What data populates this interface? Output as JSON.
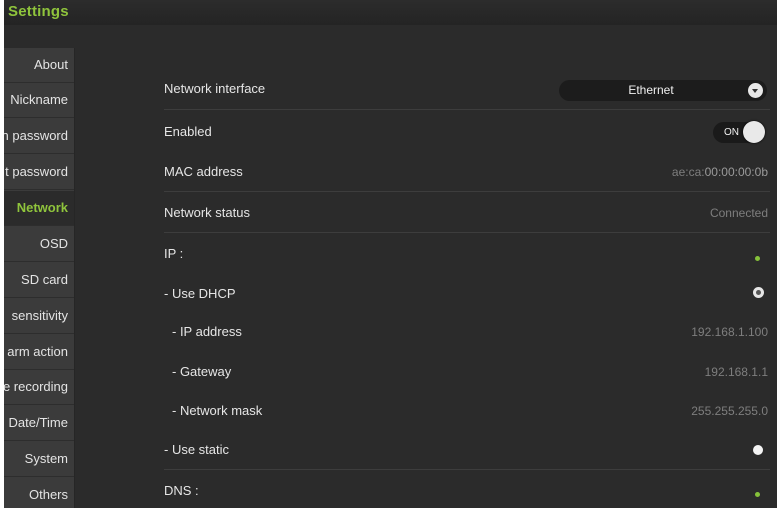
{
  "app": {
    "title": "Settings"
  },
  "sidebar": {
    "items": [
      {
        "label": "About"
      },
      {
        "label": "Nickname"
      },
      {
        "label": "n password"
      },
      {
        "label": "t password"
      },
      {
        "label": "Network",
        "active": true
      },
      {
        "label": "OSD"
      },
      {
        "label": "SD card"
      },
      {
        "label": "sensitivity"
      },
      {
        "label": "arm action"
      },
      {
        "label": "e recording"
      },
      {
        "label": "Date/Time"
      },
      {
        "label": "System"
      },
      {
        "label": "Others"
      }
    ]
  },
  "network": {
    "interface": {
      "label": "Network interface",
      "value": "Ethernet"
    },
    "enabled": {
      "label": "Enabled",
      "toggle_text": "ON",
      "state": true
    },
    "mac": {
      "label": "MAC address",
      "value_prefix": "ae:ca:",
      "value_suffix": "00:00:00:0b"
    },
    "status": {
      "label": "Network status",
      "value": "Connected"
    },
    "ip_section": {
      "label": "IP :"
    },
    "use_dhcp": {
      "label": "- Use DHCP"
    },
    "ip_address": {
      "label": "- IP address",
      "value": "192.168.1.100"
    },
    "gateway": {
      "label": "- Gateway",
      "value": "192.168.1.1"
    },
    "netmask": {
      "label": "- Network mask",
      "value": "255.255.255.0"
    },
    "use_static": {
      "label": "- Use static"
    },
    "dns_section": {
      "label": "DNS :"
    }
  },
  "colors": {
    "accent": "#8fc43c",
    "background": "#2b2b2b",
    "sidebar": "#3b3b3b"
  }
}
